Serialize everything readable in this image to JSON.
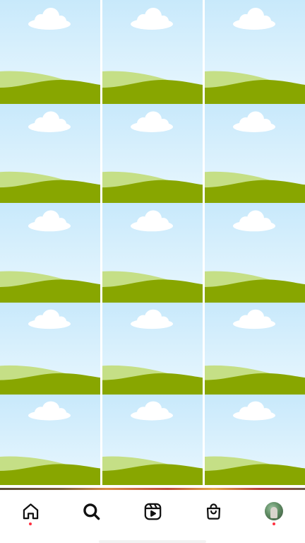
{
  "grid": {
    "tile_count": 15,
    "tile_content": "placeholder-image",
    "sky_colors": [
      "#c8e9fb",
      "#e9f7fe"
    ],
    "hill_colors": {
      "back": "#c5df86",
      "front": "#88a600"
    },
    "cloud_color": "#ffffff"
  },
  "nav": {
    "items": [
      {
        "icon": "home-icon",
        "active": true,
        "badge": true
      },
      {
        "icon": "search-icon",
        "active": true,
        "badge": false
      },
      {
        "icon": "reels-icon",
        "active": false,
        "badge": false
      },
      {
        "icon": "shop-icon",
        "active": false,
        "badge": false
      },
      {
        "icon": "profile-avatar",
        "active": false,
        "badge": true
      }
    ],
    "badge_color": "#ff3040"
  }
}
